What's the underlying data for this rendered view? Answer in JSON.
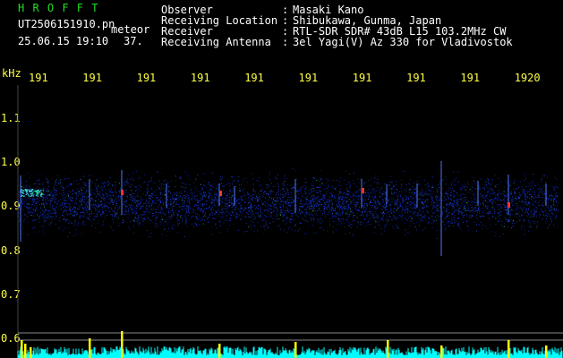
{
  "header": {
    "brand": "H R O F F T",
    "filename": "UT2506151910.pn",
    "mode": "meteor",
    "datetime": "25.06.15 19:10",
    "count": "37.",
    "fields": [
      {
        "label": "Observer",
        "sep": ":",
        "value": "Masaki Kano"
      },
      {
        "label": "Receiving Location",
        "sep": ":",
        "value": "Shibukawa, Gunma, Japan"
      },
      {
        "label": "Receiver",
        "sep": ":",
        "value": "RTL-SDR SDR# 43dB L15 103.2MHz CW"
      },
      {
        "label": "Receiving Antenna",
        "sep": ":",
        "value": "3el Yagi(V) Az 330 for Vladivostok"
      }
    ]
  },
  "axis": {
    "unit": "kHz",
    "y_labels": [
      {
        "value": 1.1,
        "text": "1.1"
      },
      {
        "value": 1.0,
        "text": "1.0"
      },
      {
        "value": 0.9,
        "text": "0.9"
      },
      {
        "value": 0.8,
        "text": "0.8"
      },
      {
        "value": 0.7,
        "text": "0.7"
      },
      {
        "value": 0.6,
        "text": "0.6"
      }
    ],
    "time_labels": [
      "191",
      "191",
      "191",
      "191",
      "191",
      "191",
      "191",
      "191",
      "191",
      "1920"
    ]
  },
  "colors": {
    "background": "#000000",
    "header_text": "#ffffff",
    "brand_text": "#22dd22",
    "axis_text": "#ffff44",
    "signal_blue": "#1a3cff",
    "signal_hot": "#ff3333",
    "power_trace": "#00ffff",
    "power_peak": "#ffff00"
  }
}
